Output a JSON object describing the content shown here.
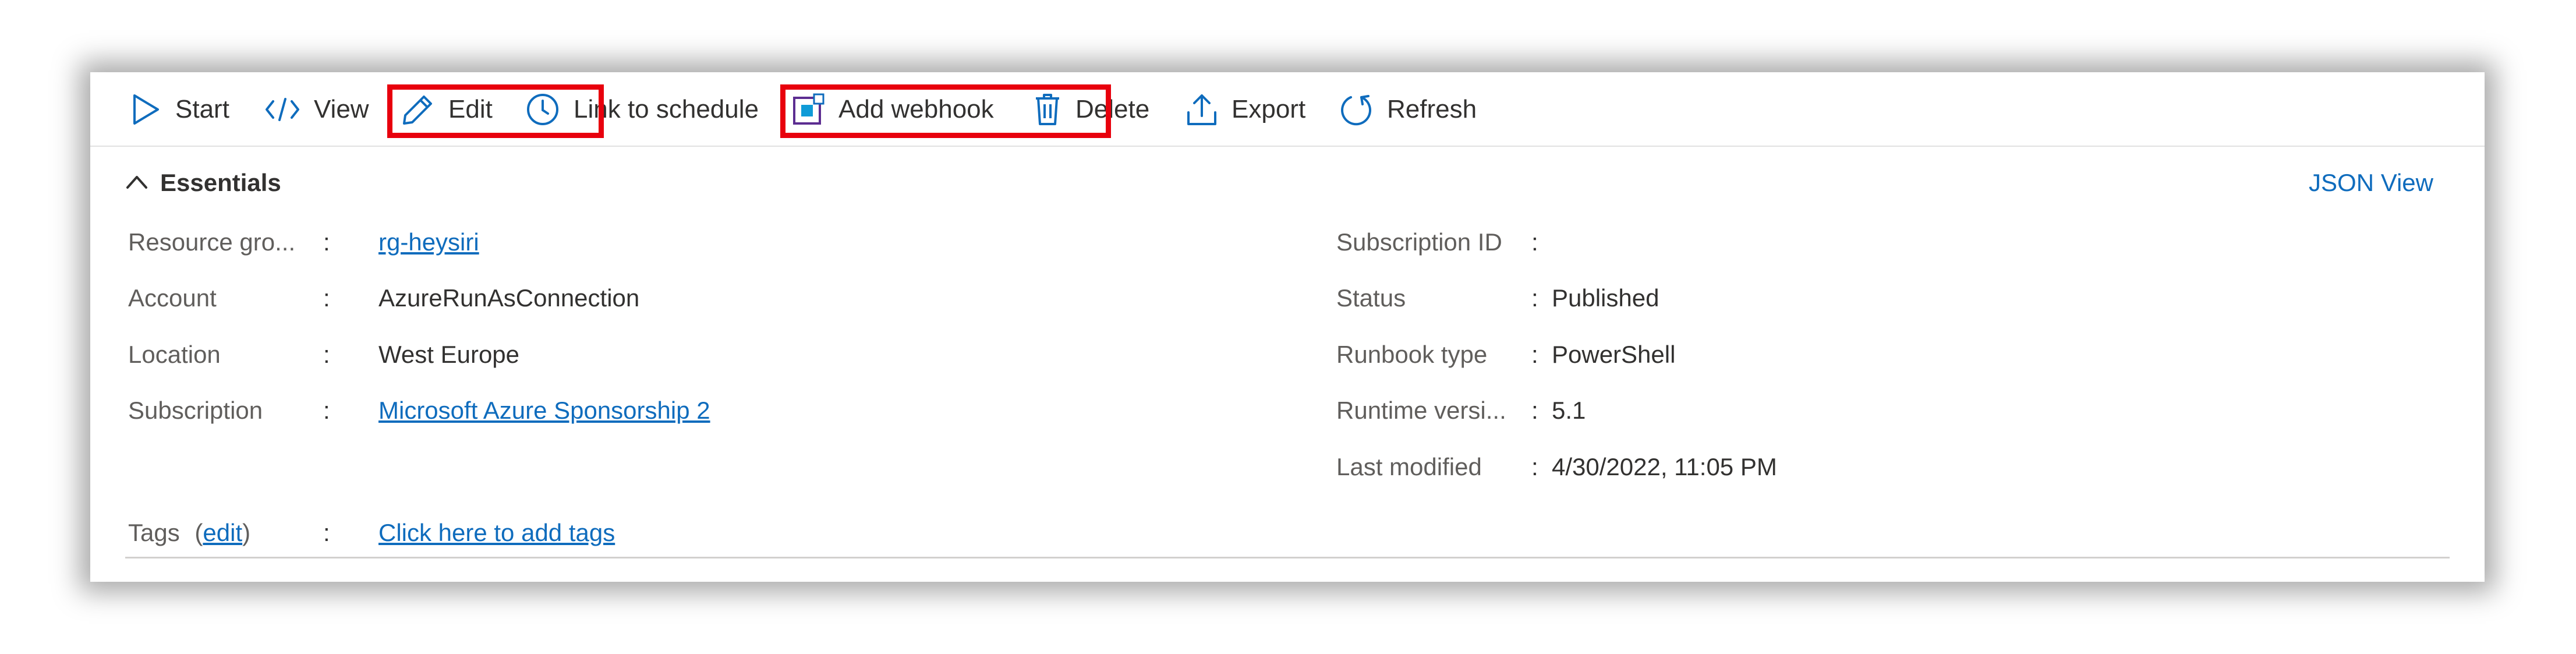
{
  "toolbar": {
    "start": "Start",
    "view": "View",
    "edit": "Edit",
    "link_to_schedule": "Link to schedule",
    "add_webhook": "Add webhook",
    "delete": "Delete",
    "export": "Export",
    "refresh": "Refresh"
  },
  "essentials": {
    "title": "Essentials",
    "json_view": "JSON View",
    "left": [
      {
        "key": "Resource gro...",
        "value": "rg-heysiri",
        "link": true
      },
      {
        "key": "Account",
        "value": "AzureRunAsConnection",
        "link": false
      },
      {
        "key": "Location",
        "value": "West Europe",
        "link": false
      },
      {
        "key": "Subscription",
        "value": "Microsoft Azure Sponsorship 2",
        "link": true
      }
    ],
    "right": [
      {
        "key": "Subscription ID",
        "value": ""
      },
      {
        "key": "Status",
        "value": "Published"
      },
      {
        "key": "Runbook type",
        "value": "PowerShell"
      },
      {
        "key": "Runtime versi...",
        "value": "5.1"
      },
      {
        "key": "Last modified",
        "value": "4/30/2022, 11:05 PM"
      }
    ],
    "tags": {
      "label": "Tags",
      "edit_open": "(",
      "edit": "edit",
      "edit_close": ")",
      "value": "Click here to add tags"
    }
  },
  "separator": ":",
  "colors": {
    "accent": "#0f6cbd",
    "highlight": "#e8000d",
    "text": "#323130",
    "muted": "#605e5c"
  }
}
